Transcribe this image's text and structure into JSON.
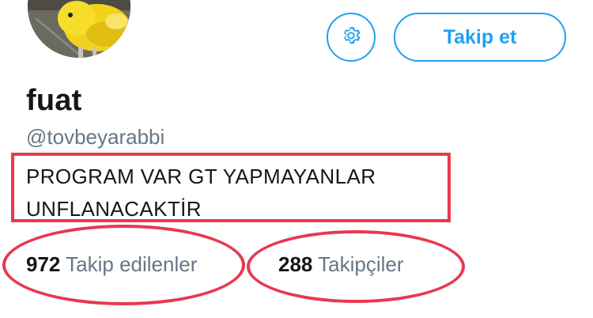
{
  "profile": {
    "display_name": "fuat",
    "handle": "@tovbeyarabbi",
    "bio_lines": [
      "PROGRAM VAR GT YAPMAYANLAR",
      "UNFLANACAKTİR"
    ]
  },
  "actions": {
    "settings_icon": "gear-icon",
    "follow_label": "Takip et"
  },
  "stats": {
    "following_count": "972",
    "following_label": "Takip edilenler",
    "followers_count": "288",
    "followers_label": "Takipçiler"
  },
  "colors": {
    "accent": "#1da1f2",
    "annotation": "#e8384f",
    "secondary_text": "#657786",
    "primary_text": "#14171a"
  }
}
